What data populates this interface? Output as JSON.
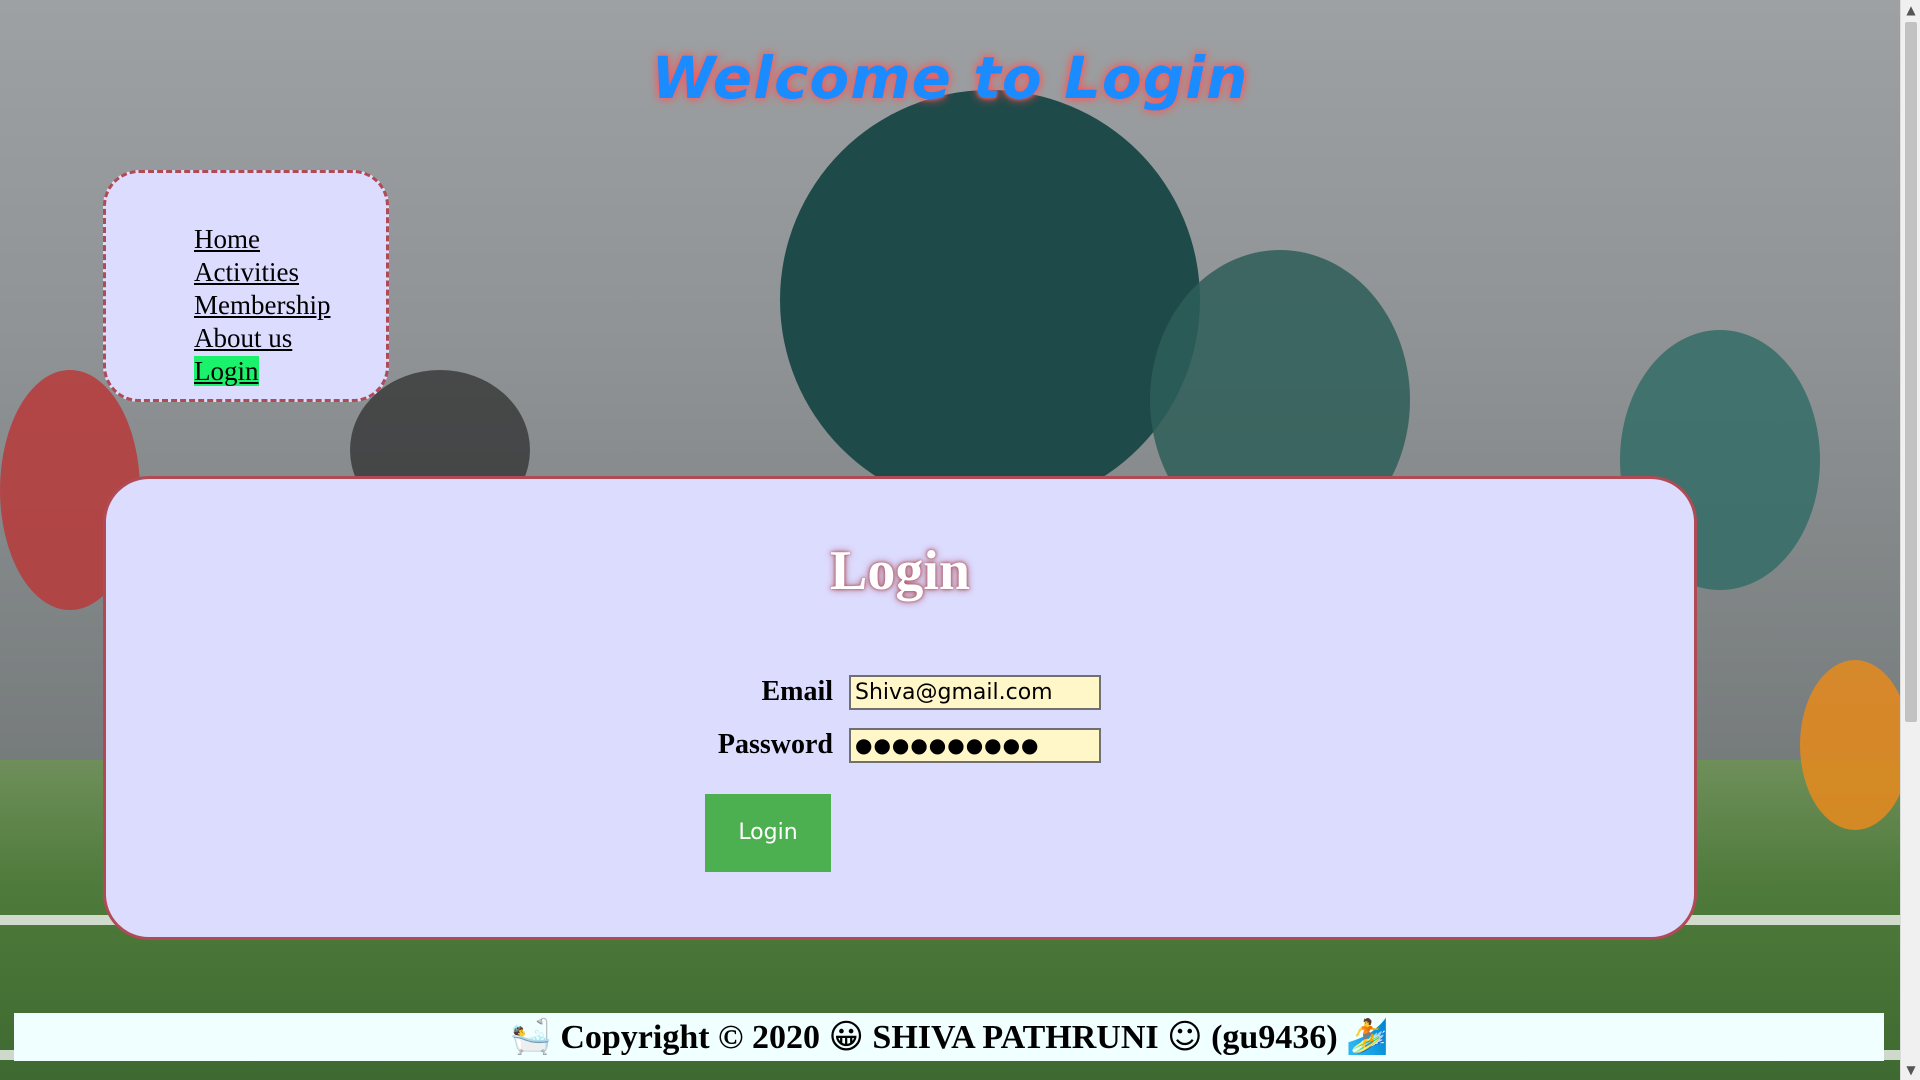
{
  "header": {
    "title": "Welcome to Login"
  },
  "nav": {
    "items": [
      {
        "label": "Home"
      },
      {
        "label": "Activities"
      },
      {
        "label": "Membership"
      },
      {
        "label": "About us"
      },
      {
        "label": "Login",
        "active": true
      }
    ]
  },
  "login": {
    "heading": "Login",
    "email_label": "Email",
    "email_value": "Shiva@gmail.com",
    "password_label": "Password",
    "password_mask": "●●●●●●●●●●",
    "submit_label": "Login"
  },
  "footer": {
    "text_left": "Copyright © 2020",
    "text_middle": "SHIVA PATHRUNI",
    "text_right": "(gu9436)",
    "icons": [
      "person-bathing-emoji",
      "grinning-face-emoji",
      "smiley-face-icon",
      "person-surfing-emoji"
    ]
  },
  "colors": {
    "title": "#1a8cff",
    "panel_bg": "#dcdcff",
    "panel_border": "#b04a55",
    "active_nav": "#19f26a",
    "button": "#4caf50",
    "input_bg": "#fff7c8",
    "footer_bg": "#f0ffff"
  }
}
